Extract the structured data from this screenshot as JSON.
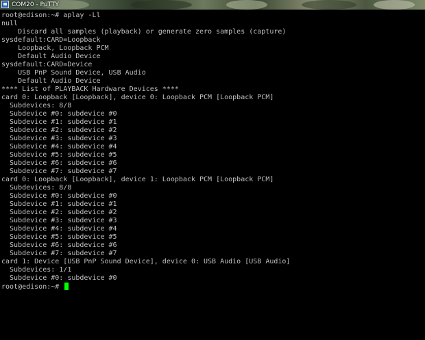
{
  "window": {
    "title": "COM20 - PuTTY"
  },
  "terminal": {
    "lines": [
      "root@edison:~# aplay -Ll",
      "null",
      "    Discard all samples (playback) or generate zero samples (capture)",
      "sysdefault:CARD=Loopback",
      "    Loopback, Loopback PCM",
      "    Default Audio Device",
      "sysdefault:CARD=Device",
      "    USB PnP Sound Device, USB Audio",
      "    Default Audio Device",
      "**** List of PLAYBACK Hardware Devices ****",
      "card 0: Loopback [Loopback], device 0: Loopback PCM [Loopback PCM]",
      "  Subdevices: 8/8",
      "  Subdevice #0: subdevice #0",
      "  Subdevice #1: subdevice #1",
      "  Subdevice #2: subdevice #2",
      "  Subdevice #3: subdevice #3",
      "  Subdevice #4: subdevice #4",
      "  Subdevice #5: subdevice #5",
      "  Subdevice #6: subdevice #6",
      "  Subdevice #7: subdevice #7",
      "card 0: Loopback [Loopback], device 1: Loopback PCM [Loopback PCM]",
      "  Subdevices: 8/8",
      "  Subdevice #0: subdevice #0",
      "  Subdevice #1: subdevice #1",
      "  Subdevice #2: subdevice #2",
      "  Subdevice #3: subdevice #3",
      "  Subdevice #4: subdevice #4",
      "  Subdevice #5: subdevice #5",
      "  Subdevice #6: subdevice #6",
      "  Subdevice #7: subdevice #7",
      "card 1: Device [USB PnP Sound Device], device 0: USB Audio [USB Audio]",
      "  Subdevices: 1/1",
      "  Subdevice #0: subdevice #0"
    ],
    "prompt": "root@edison:~# ",
    "cursor_color": "#00ff00",
    "text_color": "#c0c0c0",
    "background_color": "#000000"
  },
  "icons": {
    "app_icon": "putty-terminal-icon"
  }
}
